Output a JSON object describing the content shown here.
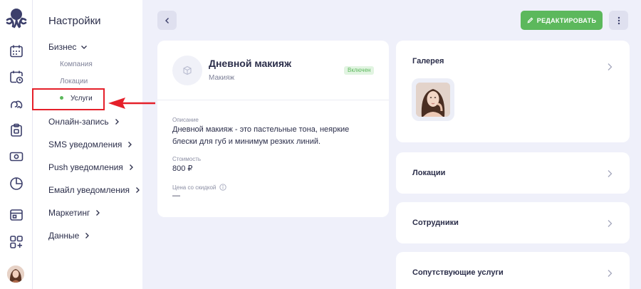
{
  "settings": {
    "title": "Настройки",
    "business": "Бизнес",
    "sub": [
      "Компания",
      "Локации",
      "Услуги"
    ],
    "menu": [
      "Онлайн-запись",
      "SMS уведомления",
      "Push уведомления",
      "Емайл уведомления",
      "Маркетинг",
      "Данные"
    ]
  },
  "toolbar": {
    "edit_label": "РЕДАКТИРОВАТЬ"
  },
  "service": {
    "name": "Дневной макияж",
    "category": "Макияж",
    "status": "Включен",
    "description_label": "Описание",
    "description": "Дневной макияж - это пастельные тона, неяркие блески для губ и минимум резких линий.",
    "price_label": "Стоимость",
    "price": "800 ₽",
    "discount_label": "Цена со скидкой",
    "discount": "—"
  },
  "right": {
    "gallery": "Галерея",
    "locations": "Локации",
    "staff": "Сотрудники",
    "related": "Сопутствующие услуги"
  },
  "colors": {
    "accent_green": "#5cb85c",
    "highlight_red": "#e5202a",
    "background": "#eff0fa"
  }
}
